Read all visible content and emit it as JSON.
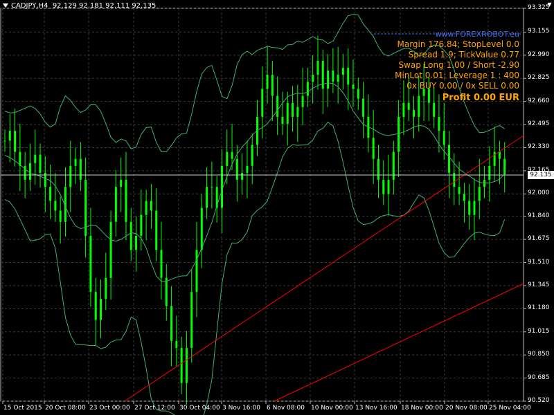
{
  "header": {
    "symbol": "CADJPY,H4",
    "ohlc": "92.129 92.181 92.111 92.135"
  },
  "info_panel": {
    "url": "www.FOREXROBOT.eu",
    "lines": [
      "Margin 176.84; StopLevel 0.0",
      "Spread 1.9; TickValue 0.77",
      "Swap Long 1.00 / Short -2.90",
      "MinLot 0.01; Leverage 1 : 400",
      "0x BUY 0.00 / 0x SELL 0.00"
    ],
    "profit": "Profit 0.00 EUR"
  },
  "price_labels": [
    "93.325",
    "93.155",
    "92.990",
    "92.825",
    "92.660",
    "92.495",
    "92.330",
    "92.165",
    "92.000",
    "91.840",
    "91.675",
    "91.510",
    "91.345",
    "91.180",
    "91.015",
    "90.850",
    "90.685",
    "90.520"
  ],
  "current_price": "92.135",
  "time_labels": [
    "15 Oct 2015",
    "20 Oct 08:00",
    "23 Oct 00:00",
    "27 Oct 12:00",
    "30 Oct 04:00",
    "3 Nov 16:00",
    "6 Nov 08:00",
    "10 Nov 00:00",
    "13 Nov 16:00",
    "18 Nov 00:00",
    "20 Nov 08:00",
    "25 Nov 04:00"
  ],
  "colors": {
    "bg": "#000000",
    "candle": "#00ff00",
    "band": "#3cb371",
    "trend": "#ff0000",
    "grid": "#3a3a3a"
  },
  "chart_data": {
    "type": "line",
    "description_series": "H4 candlestick chart CADJPY with Bollinger-style envelope bands and two red trendlines",
    "ylim": [
      90.5,
      93.33
    ],
    "series": [
      {
        "name": "",
        "values": [
          92.38,
          92.45,
          92.3,
          92.2,
          92.1,
          92.22,
          92.28,
          92.15,
          92.05,
          91.95,
          91.88,
          91.8,
          92.05,
          92.2,
          92.25,
          92.1,
          91.7,
          91.3,
          91.1,
          91.25,
          91.4,
          91.8,
          92.05,
          92.1,
          91.8,
          91.6,
          91.7,
          91.85,
          91.95,
          91.88,
          91.6,
          91.4,
          91.2,
          90.95,
          90.9,
          90.65,
          90.9,
          91.3,
          91.6,
          91.9,
          92.05,
          92.05,
          91.9,
          92.2,
          92.3,
          92.25,
          92.1,
          92.15,
          92.2,
          92.35,
          92.55,
          92.75,
          92.85,
          92.7,
          92.55,
          92.5,
          92.65,
          92.55,
          92.62,
          92.7,
          92.8,
          92.85,
          92.95,
          92.75,
          92.88,
          92.8,
          92.85,
          92.9,
          92.78,
          92.75,
          92.68,
          92.55,
          92.4,
          92.25,
          92.1,
          92.0,
          92.1,
          92.3,
          92.55,
          92.65,
          92.6,
          92.55,
          92.7,
          92.75,
          92.65,
          92.55,
          92.45,
          92.35,
          92.15,
          92.05,
          92.0,
          91.95,
          91.85,
          91.95,
          92.05,
          92.1,
          92.2,
          92.3,
          92.25,
          92.14
        ]
      }
    ]
  }
}
